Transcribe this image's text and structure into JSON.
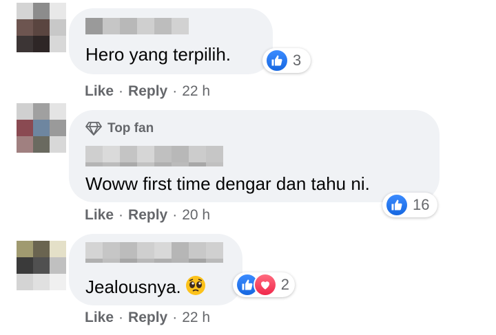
{
  "colors": {
    "bubble_bg": "#f0f2f5",
    "secondary_text": "#65676b",
    "like_blue": "#1877f2",
    "love_red": "#f33e58"
  },
  "comments": [
    {
      "text": "Hero yang terpilih.",
      "badge": "",
      "reactions": {
        "icons": [
          "like-icon"
        ],
        "count": "3"
      },
      "actions": {
        "like": "Like",
        "reply": "Reply",
        "time": "22 h"
      }
    },
    {
      "text": "Woww first time dengar dan tahu ni.",
      "badge": "Top fan",
      "badge_icon": "diamond-icon",
      "reactions": {
        "icons": [
          "like-icon"
        ],
        "count": "16"
      },
      "actions": {
        "like": "Like",
        "reply": "Reply",
        "time": "20 h"
      }
    },
    {
      "text": "Jealousnya.",
      "emoji": "pleading-face-emoji",
      "badge": "",
      "reactions": {
        "icons": [
          "like-icon",
          "love-icon"
        ],
        "count": "2"
      },
      "actions": {
        "like": "Like",
        "reply": "Reply",
        "time": "22 h"
      }
    }
  ],
  "separator": "·"
}
